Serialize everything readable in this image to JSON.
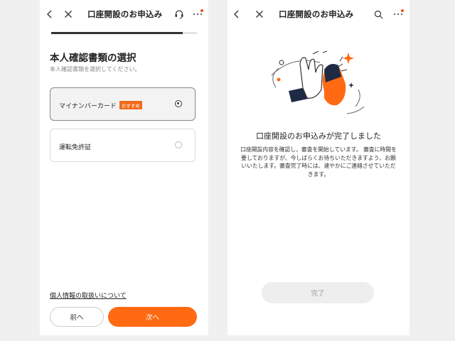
{
  "left": {
    "header": {
      "title": "口座開設のお申込み"
    },
    "progress": {
      "fraction": 0.9
    },
    "section": {
      "title": "本人確認書類の選択",
      "subtitle": "本人確認書類を選択してください。"
    },
    "options": [
      {
        "label": "マイナンバーカード",
        "badge": "おすすめ",
        "selected": true
      },
      {
        "label": "運転免許証",
        "selected": false
      }
    ],
    "privacy_link": "個人情報の取扱いについて",
    "buttons": {
      "prev": "前へ",
      "next": "次へ"
    },
    "colors": {
      "accent": "#ff6a13",
      "badge": "#f26a1b"
    }
  },
  "right": {
    "header": {
      "title": "口座開設のお申込み"
    },
    "complete": {
      "title": "口座開設のお申込みが完了しました",
      "description": "口座開設内容を確認し、審査を開始しています。 審査に時間を要しておりますが、今しばらくお待ちいただきますよう、お願いいたします。審査完了時には、速やかにご連絡させていただきます。"
    },
    "buttons": {
      "done": "完了"
    }
  }
}
